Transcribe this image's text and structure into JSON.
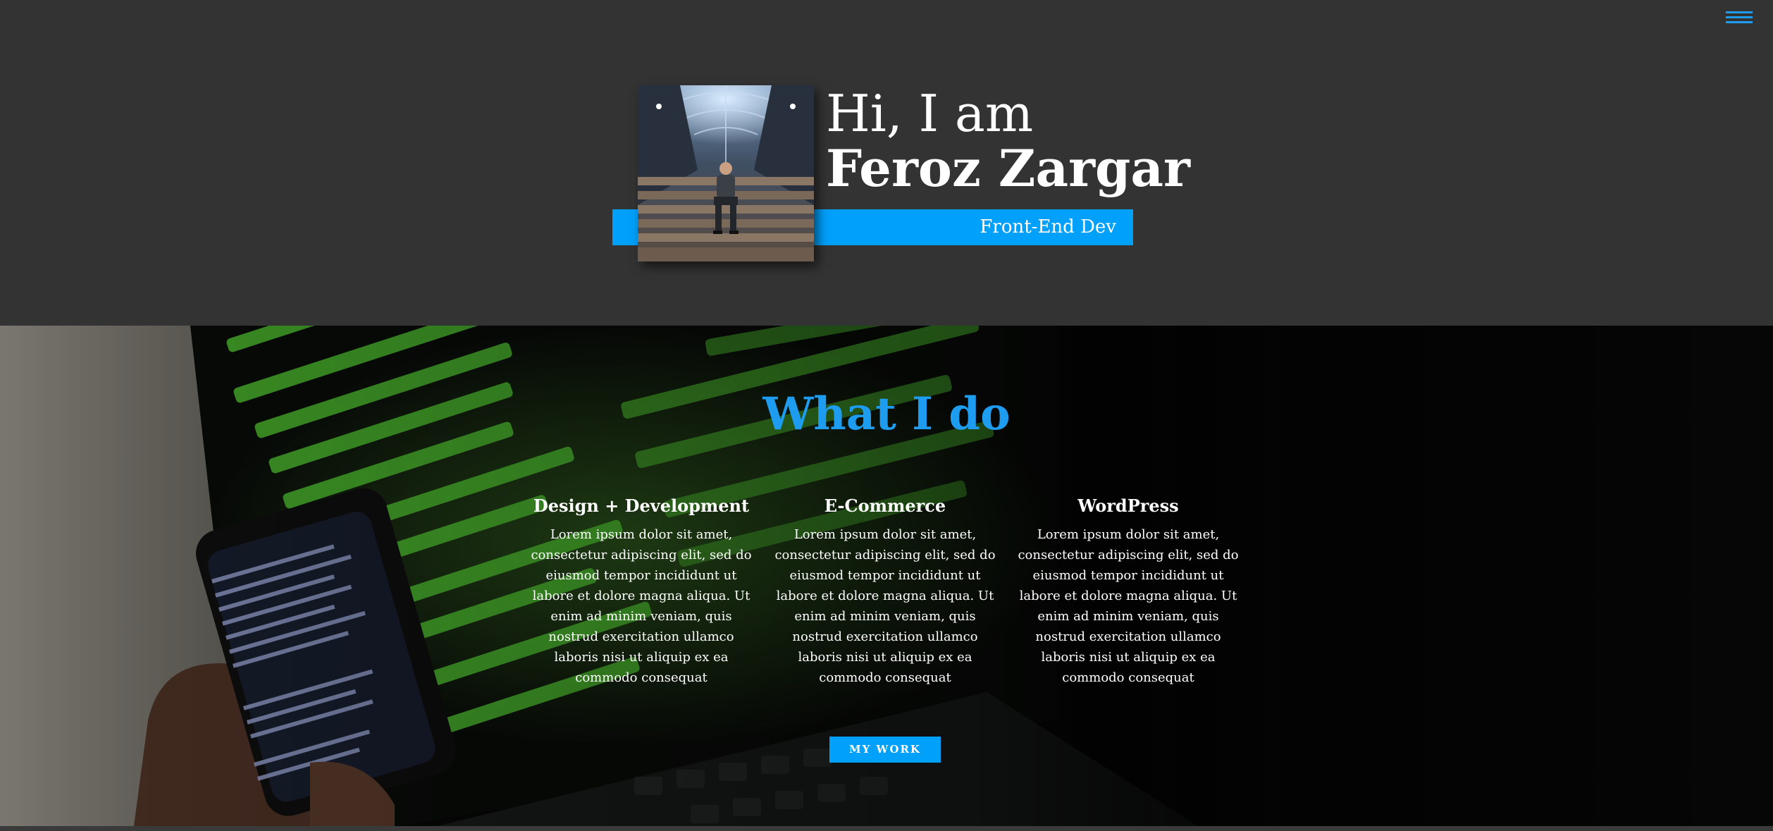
{
  "nav": {
    "menu_icon": "hamburger-menu-icon"
  },
  "hero": {
    "greeting": "Hi, I am",
    "name": "Feroz Zargar",
    "role": "Front-End Dev",
    "accent_color": "#00a0fb",
    "background_color": "#333333"
  },
  "services": {
    "title": "What I do",
    "title_color": "#1e9cf0",
    "items": [
      {
        "title": "Design + Development",
        "description": "Lorem ipsum dolor sit amet, consectetur adipiscing elit, sed do eiusmod tempor incididunt ut labore et dolore magna aliqua. Ut enim ad minim veniam, quis nostrud exercitation ullamco laboris nisi ut aliquip ex ea commodo consequat"
      },
      {
        "title": "E-Commerce",
        "description": "Lorem ipsum dolor sit amet, consectetur adipiscing elit, sed do eiusmod tempor incididunt ut labore et dolore magna aliqua. Ut enim ad minim veniam, quis nostrud exercitation ullamco laboris nisi ut aliquip ex ea commodo consequat"
      },
      {
        "title": "WordPress",
        "description": "Lorem ipsum dolor sit amet, consectetur adipiscing elit, sed do eiusmod tempor incididunt ut labore et dolore magna aliqua. Ut enim ad minim veniam, quis nostrud exercitation ullamco laboris nisi ut aliquip ex ea commodo consequat"
      }
    ],
    "button_label": "MY WORK"
  }
}
